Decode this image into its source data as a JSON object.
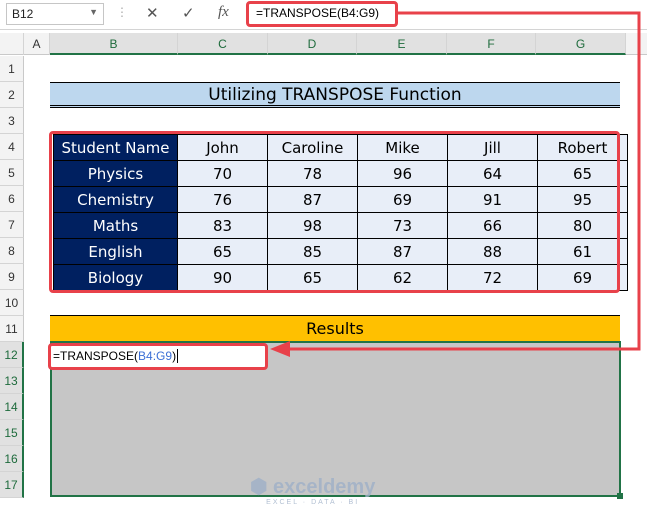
{
  "formula_bar": {
    "name_box": "B12",
    "formula": "=TRANSPOSE(B4:G9)",
    "cancel_icon": "✕",
    "enter_icon": "✓",
    "fx_icon": "fx"
  },
  "columns": [
    "A",
    "B",
    "C",
    "D",
    "E",
    "F",
    "G"
  ],
  "rows": [
    "1",
    "2",
    "3",
    "4",
    "5",
    "6",
    "7",
    "8",
    "9",
    "10",
    "11",
    "12",
    "13",
    "14",
    "15",
    "16",
    "17"
  ],
  "title": "Utilizing TRANSPOSE Function",
  "table": {
    "header": [
      "Student Name",
      "John",
      "Caroline",
      "Mike",
      "Jill",
      "Robert"
    ],
    "rows": [
      [
        "Physics",
        "70",
        "78",
        "96",
        "64",
        "65"
      ],
      [
        "Chemistry",
        "76",
        "87",
        "69",
        "91",
        "95"
      ],
      [
        "Maths",
        "83",
        "98",
        "73",
        "66",
        "80"
      ],
      [
        "English",
        "65",
        "85",
        "87",
        "88",
        "61"
      ],
      [
        "Biology",
        "90",
        "65",
        "62",
        "72",
        "69"
      ]
    ]
  },
  "results_label": "Results",
  "editor": {
    "prefix": "=TRANSPOSE(",
    "ref": "B4:G9",
    "suffix": ")"
  },
  "watermark": {
    "name": "exceldemy",
    "tagline": "EXCEL · DATA · BI"
  },
  "colors": {
    "accent": "#217346",
    "highlight": "#e8414a",
    "header_bg": "#002060",
    "results_bg": "#ffc000",
    "title_bg": "#bdd7ee"
  }
}
